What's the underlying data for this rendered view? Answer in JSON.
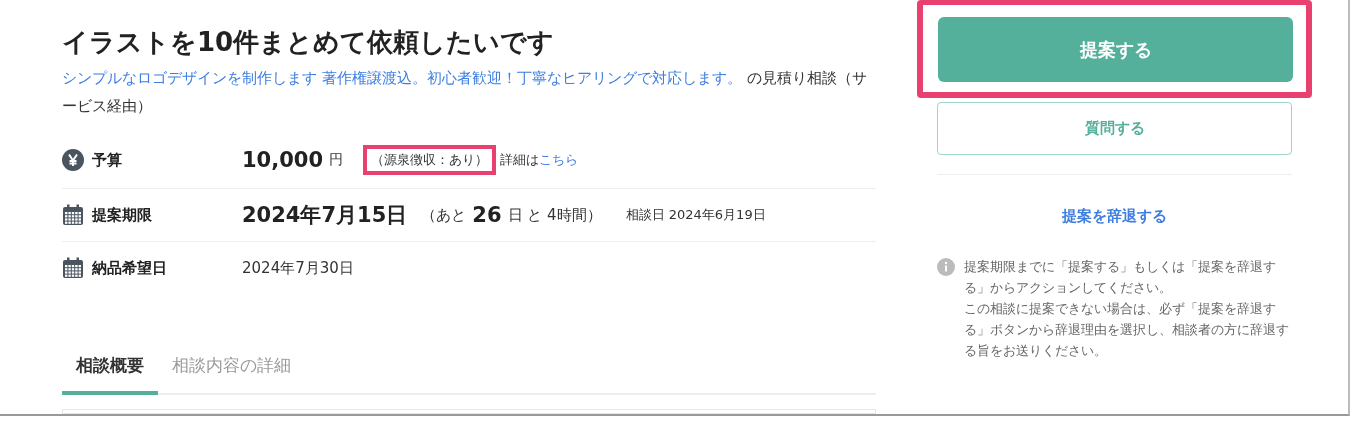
{
  "title": "イラストを10件まとめて依頼したいです",
  "subtitle": {
    "link": "シンプルなロゴデザインを制作します 著作権譲渡込。初心者歓迎！丁寧なヒアリングで対応します。",
    "suffix": "の見積り相談（サービス経由）"
  },
  "details": [
    {
      "kind": "budget",
      "label": "予算",
      "amount": "10,000",
      "unit": "円",
      "note": "（源泉徴収：あり）",
      "note_highlighted": true,
      "detail_prefix": "詳細は",
      "detail_link": "こちら"
    },
    {
      "kind": "deadline",
      "label": "提案期限",
      "date": "2024年7月15日",
      "remaining_prefix": "（あと",
      "remaining_days": "26",
      "remaining_suffix": "日 と 4時間）",
      "consulted": "相談日 2024年6月19日"
    },
    {
      "kind": "delivery",
      "label": "納品希望日",
      "date": "2024年7月30日"
    }
  ],
  "tabs": [
    {
      "label": "相談概要",
      "selected": true
    },
    {
      "label": "相談内容の詳細",
      "selected": false
    }
  ],
  "actions": {
    "propose": {
      "label": "提案する",
      "highlighted": true
    },
    "ask": "質問する",
    "decline": "提案を辞退する"
  },
  "notice": [
    "提案期限までに「提案する」もしくは「提案を辞退する」からアクションしてください。",
    "この相談に提案できない場合は、必ず「提案を辞退する」ボタンから辞退理由を選択し、相談者の方に辞退する旨をお送りください。"
  ]
}
